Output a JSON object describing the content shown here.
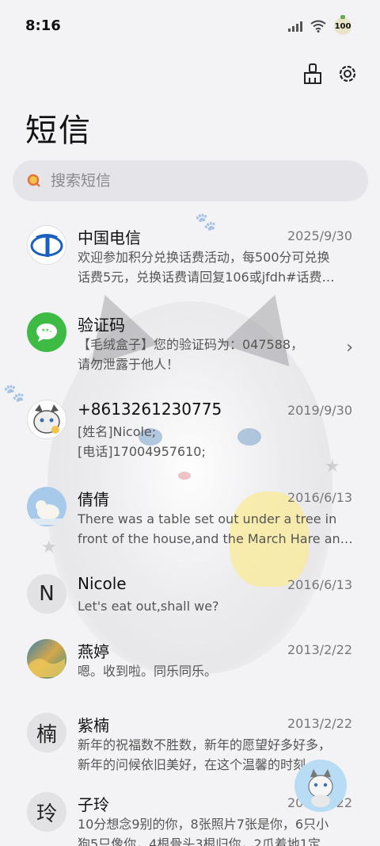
{
  "status": {
    "time": "8:16",
    "battery": "100"
  },
  "toolbar": {
    "icons": [
      "brush-icon",
      "settings-icon"
    ]
  },
  "title": "短信",
  "search": {
    "placeholder": "搜索短信"
  },
  "conversations": [
    {
      "name": "中国电信",
      "date": "2025/9/30",
      "lines": [
        "欢迎参加积分兑换话费活动，每500分可兑换",
        "话费5元，兑换话费请回复106或jfdh#话费…"
      ],
      "avatar": "china-telecom-logo"
    },
    {
      "name": "验证码",
      "date": "",
      "lines": [
        "【毛绒盒子】您的验证码为：047588，",
        "请勿泄露于他人！"
      ],
      "avatar": "sms-bubble-icon"
    },
    {
      "name": "+8613261230775",
      "date": "2019/9/30",
      "lines": [
        "[姓名]Nicole;",
        "[电话]17004957610;"
      ],
      "avatar": "cat-photo"
    },
    {
      "name": "倩倩",
      "date": "2016/6/13",
      "lines": [
        "There was a table set out under a tree in",
        "front of the house,and the March Hare an…"
      ],
      "avatar": "polar-bear-photo"
    },
    {
      "name": "Nicole",
      "date": "2016/6/13",
      "lines": [
        "Let's eat out,shall we?"
      ],
      "avatar_letter": "N"
    },
    {
      "name": "燕婷",
      "date": "2013/2/22",
      "lines": [
        "嗯。收到啦。同乐同乐。"
      ],
      "avatar": "landscape-photo"
    },
    {
      "name": "紫楠",
      "date": "2013/2/22",
      "lines": [
        "新年的祝福数不胜数，新年的愿望好多好多，",
        "新年的问候依旧美好，在这个温馨的时刻，…"
      ],
      "avatar_letter": "楠"
    },
    {
      "name": "子玲",
      "date": "2013/2/22",
      "lines": [
        "10分想念9别的你，8张照片7张是你，6只小",
        "狗5只像你，4根骨头3根归你，2爪着地1定…"
      ],
      "avatar_letter": "玲"
    }
  ],
  "colors": {
    "background": "#f3f3f5",
    "accent_green": "#3dbb45",
    "telecom_blue": "#1b5fc1"
  }
}
